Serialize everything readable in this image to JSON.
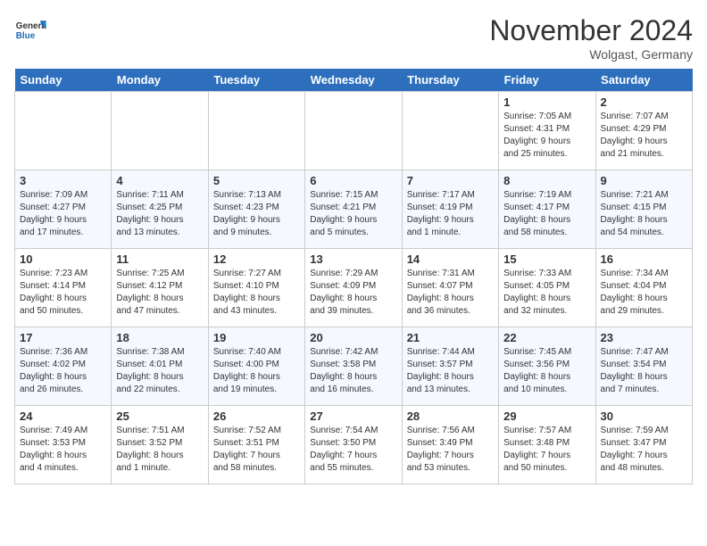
{
  "header": {
    "logo_general": "General",
    "logo_blue": "Blue",
    "month_year": "November 2024",
    "location": "Wolgast, Germany"
  },
  "days_of_week": [
    "Sunday",
    "Monday",
    "Tuesday",
    "Wednesday",
    "Thursday",
    "Friday",
    "Saturday"
  ],
  "weeks": [
    [
      {
        "day": "",
        "info": ""
      },
      {
        "day": "",
        "info": ""
      },
      {
        "day": "",
        "info": ""
      },
      {
        "day": "",
        "info": ""
      },
      {
        "day": "",
        "info": ""
      },
      {
        "day": "1",
        "info": "Sunrise: 7:05 AM\nSunset: 4:31 PM\nDaylight: 9 hours\nand 25 minutes."
      },
      {
        "day": "2",
        "info": "Sunrise: 7:07 AM\nSunset: 4:29 PM\nDaylight: 9 hours\nand 21 minutes."
      }
    ],
    [
      {
        "day": "3",
        "info": "Sunrise: 7:09 AM\nSunset: 4:27 PM\nDaylight: 9 hours\nand 17 minutes."
      },
      {
        "day": "4",
        "info": "Sunrise: 7:11 AM\nSunset: 4:25 PM\nDaylight: 9 hours\nand 13 minutes."
      },
      {
        "day": "5",
        "info": "Sunrise: 7:13 AM\nSunset: 4:23 PM\nDaylight: 9 hours\nand 9 minutes."
      },
      {
        "day": "6",
        "info": "Sunrise: 7:15 AM\nSunset: 4:21 PM\nDaylight: 9 hours\nand 5 minutes."
      },
      {
        "day": "7",
        "info": "Sunrise: 7:17 AM\nSunset: 4:19 PM\nDaylight: 9 hours\nand 1 minute."
      },
      {
        "day": "8",
        "info": "Sunrise: 7:19 AM\nSunset: 4:17 PM\nDaylight: 8 hours\nand 58 minutes."
      },
      {
        "day": "9",
        "info": "Sunrise: 7:21 AM\nSunset: 4:15 PM\nDaylight: 8 hours\nand 54 minutes."
      }
    ],
    [
      {
        "day": "10",
        "info": "Sunrise: 7:23 AM\nSunset: 4:14 PM\nDaylight: 8 hours\nand 50 minutes."
      },
      {
        "day": "11",
        "info": "Sunrise: 7:25 AM\nSunset: 4:12 PM\nDaylight: 8 hours\nand 47 minutes."
      },
      {
        "day": "12",
        "info": "Sunrise: 7:27 AM\nSunset: 4:10 PM\nDaylight: 8 hours\nand 43 minutes."
      },
      {
        "day": "13",
        "info": "Sunrise: 7:29 AM\nSunset: 4:09 PM\nDaylight: 8 hours\nand 39 minutes."
      },
      {
        "day": "14",
        "info": "Sunrise: 7:31 AM\nSunset: 4:07 PM\nDaylight: 8 hours\nand 36 minutes."
      },
      {
        "day": "15",
        "info": "Sunrise: 7:33 AM\nSunset: 4:05 PM\nDaylight: 8 hours\nand 32 minutes."
      },
      {
        "day": "16",
        "info": "Sunrise: 7:34 AM\nSunset: 4:04 PM\nDaylight: 8 hours\nand 29 minutes."
      }
    ],
    [
      {
        "day": "17",
        "info": "Sunrise: 7:36 AM\nSunset: 4:02 PM\nDaylight: 8 hours\nand 26 minutes."
      },
      {
        "day": "18",
        "info": "Sunrise: 7:38 AM\nSunset: 4:01 PM\nDaylight: 8 hours\nand 22 minutes."
      },
      {
        "day": "19",
        "info": "Sunrise: 7:40 AM\nSunset: 4:00 PM\nDaylight: 8 hours\nand 19 minutes."
      },
      {
        "day": "20",
        "info": "Sunrise: 7:42 AM\nSunset: 3:58 PM\nDaylight: 8 hours\nand 16 minutes."
      },
      {
        "day": "21",
        "info": "Sunrise: 7:44 AM\nSunset: 3:57 PM\nDaylight: 8 hours\nand 13 minutes."
      },
      {
        "day": "22",
        "info": "Sunrise: 7:45 AM\nSunset: 3:56 PM\nDaylight: 8 hours\nand 10 minutes."
      },
      {
        "day": "23",
        "info": "Sunrise: 7:47 AM\nSunset: 3:54 PM\nDaylight: 8 hours\nand 7 minutes."
      }
    ],
    [
      {
        "day": "24",
        "info": "Sunrise: 7:49 AM\nSunset: 3:53 PM\nDaylight: 8 hours\nand 4 minutes."
      },
      {
        "day": "25",
        "info": "Sunrise: 7:51 AM\nSunset: 3:52 PM\nDaylight: 8 hours\nand 1 minute."
      },
      {
        "day": "26",
        "info": "Sunrise: 7:52 AM\nSunset: 3:51 PM\nDaylight: 7 hours\nand 58 minutes."
      },
      {
        "day": "27",
        "info": "Sunrise: 7:54 AM\nSunset: 3:50 PM\nDaylight: 7 hours\nand 55 minutes."
      },
      {
        "day": "28",
        "info": "Sunrise: 7:56 AM\nSunset: 3:49 PM\nDaylight: 7 hours\nand 53 minutes."
      },
      {
        "day": "29",
        "info": "Sunrise: 7:57 AM\nSunset: 3:48 PM\nDaylight: 7 hours\nand 50 minutes."
      },
      {
        "day": "30",
        "info": "Sunrise: 7:59 AM\nSunset: 3:47 PM\nDaylight: 7 hours\nand 48 minutes."
      }
    ]
  ]
}
